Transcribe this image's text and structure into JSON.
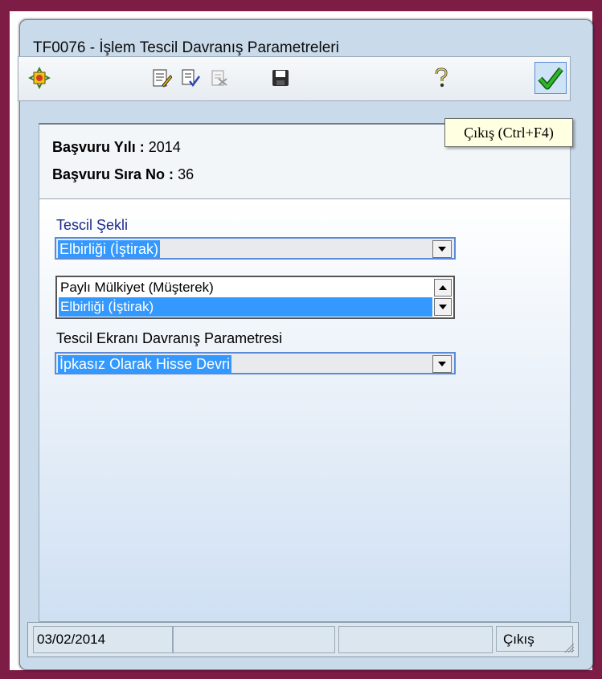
{
  "window": {
    "title": "TF0076 - İşlem Tescil Davranış Parametreleri"
  },
  "toolbar": {
    "buttons": [
      {
        "icon": "compass-icon"
      },
      {
        "icon": "document-edit-icon"
      },
      {
        "icon": "document-check-icon"
      },
      {
        "icon": "document-delete-icon"
      },
      {
        "icon": "save-icon"
      },
      {
        "icon": "help-icon"
      },
      {
        "icon": "checkmark-icon"
      }
    ],
    "tooltip": "Çıkış (Ctrl+F4)"
  },
  "info": {
    "year_label": "Başvuru Yılı :",
    "year_value": "2014",
    "seq_label": "Başvuru Sıra No :",
    "seq_value": "36"
  },
  "form": {
    "tescil_sekli_label": "Tescil Şekli",
    "tescil_sekli_value": "Elbirliği (İştirak)",
    "tescil_sekli_options": [
      "Paylı Mülkiyet (Müşterek)",
      "Elbirliği (İştirak)"
    ],
    "davranis_label": "Tescil Ekranı Davranış Parametresi",
    "davranis_value": "İpkasız Olarak Hisse Devri"
  },
  "status": {
    "date": "03/02/2014",
    "exit_label": "Çıkış"
  },
  "colors": {
    "frame": "#7d1c44",
    "selection": "#3399ff",
    "window": "#c9daea"
  }
}
